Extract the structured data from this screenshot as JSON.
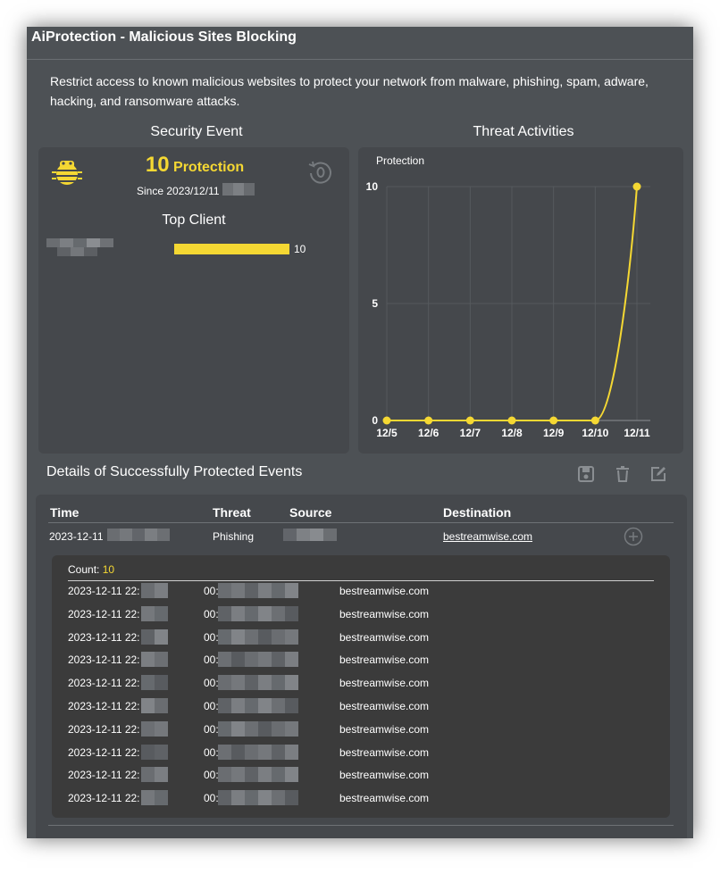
{
  "window": {
    "title": "AiProtection - Malicious Sites Blocking"
  },
  "description": "Restrict access to known malicious websites to protect your network from malware, phishing, spam, adware, hacking, and ransomware attacks.",
  "security_event": {
    "heading": "Security Event",
    "count": "10",
    "count_label": "Protection",
    "since": "Since 2023/12/11",
    "top_client_heading": "Top Client",
    "top_client_value": "10",
    "top_client_fraction": 1.0
  },
  "threat_activities": {
    "heading": "Threat Activities"
  },
  "chart_data": {
    "type": "line",
    "series": [
      {
        "name": "Protection",
        "values": [
          0,
          0,
          0,
          0,
          0,
          0,
          10
        ]
      }
    ],
    "categories": [
      "12/5",
      "12/6",
      "12/7",
      "12/8",
      "12/9",
      "12/10",
      "12/11"
    ],
    "yticks": [
      "0",
      "5",
      "10"
    ],
    "ylim": [
      0,
      10
    ],
    "legend": "top-left",
    "grid": true,
    "color": "#f5d833"
  },
  "details": {
    "heading": "Details of Successfully Protected Events",
    "columns": [
      "Time",
      "Threat",
      "Source",
      "Destination"
    ],
    "row": {
      "time": "2023-12-11",
      "threat": "Phishing",
      "destination": "bestreamwise.com"
    },
    "count_label": "Count:",
    "count_value": "10",
    "events": [
      {
        "time": "2023-12-11 22:",
        "source": "00:",
        "destination": "bestreamwise.com"
      },
      {
        "time": "2023-12-11 22:",
        "source": "00:",
        "destination": "bestreamwise.com"
      },
      {
        "time": "2023-12-11 22:",
        "source": "00:",
        "destination": "bestreamwise.com"
      },
      {
        "time": "2023-12-11 22:",
        "source": "00:",
        "destination": "bestreamwise.com"
      },
      {
        "time": "2023-12-11 22:",
        "source": "00:",
        "destination": "bestreamwise.com"
      },
      {
        "time": "2023-12-11 22:",
        "source": "00:",
        "destination": "bestreamwise.com"
      },
      {
        "time": "2023-12-11 22:",
        "source": "00:",
        "destination": "bestreamwise.com"
      },
      {
        "time": "2023-12-11 22:",
        "source": "00:",
        "destination": "bestreamwise.com"
      },
      {
        "time": "2023-12-11 22:",
        "source": "00:",
        "destination": "bestreamwise.com"
      },
      {
        "time": "2023-12-11 22:",
        "source": "00:",
        "destination": "bestreamwise.com"
      }
    ]
  },
  "icons": {
    "bug": "bug-icon",
    "reset": "reset-history-icon",
    "save": "save-icon",
    "delete": "trash-icon",
    "edit": "edit-icon",
    "expand": "expand-plus-icon"
  },
  "colors": {
    "accent": "#f5d833",
    "background": "#4d5155",
    "panel": "#45484c",
    "event_panel": "#3b3b3b"
  }
}
